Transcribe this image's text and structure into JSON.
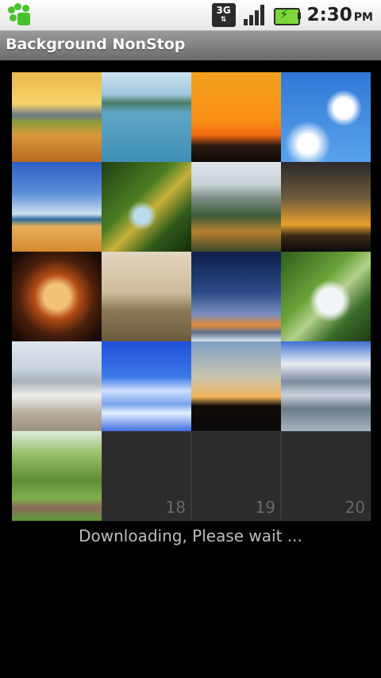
{
  "status_bar": {
    "app_icon": "paw-icon",
    "network_type": "3G",
    "network_arrows": "⇅",
    "signal_icon": "signal-icon",
    "battery_icon": "battery-charging-icon",
    "time": "2:30",
    "ampm": "PM"
  },
  "title_bar": {
    "title": "Background NonStop"
  },
  "grid": {
    "tiles": [
      {
        "type": "image",
        "name": "thumb-sunset-grassland"
      },
      {
        "type": "image",
        "name": "thumb-lake-island"
      },
      {
        "type": "image",
        "name": "thumb-orange-sunset"
      },
      {
        "type": "image",
        "name": "thumb-blue-sky-clouds"
      },
      {
        "type": "image",
        "name": "thumb-beach-waves"
      },
      {
        "type": "image",
        "name": "thumb-forest-river"
      },
      {
        "type": "image",
        "name": "thumb-mountain-valley"
      },
      {
        "type": "image",
        "name": "thumb-dark-sunset"
      },
      {
        "type": "image",
        "name": "thumb-window-view"
      },
      {
        "type": "image",
        "name": "thumb-loading-sepia"
      },
      {
        "type": "image",
        "name": "thumb-blue-dusk"
      },
      {
        "type": "image",
        "name": "thumb-waterfall"
      },
      {
        "type": "image",
        "name": "thumb-frosty-field"
      },
      {
        "type": "image",
        "name": "thumb-snowy-clouds"
      },
      {
        "type": "image",
        "name": "thumb-palm-sunset"
      },
      {
        "type": "image",
        "name": "thumb-harbor"
      },
      {
        "type": "image",
        "name": "thumb-park-path"
      },
      {
        "type": "placeholder",
        "number": "18"
      },
      {
        "type": "placeholder",
        "number": "19"
      },
      {
        "type": "placeholder",
        "number": "20"
      }
    ]
  },
  "status_message": "Downloading, Please wait ..."
}
